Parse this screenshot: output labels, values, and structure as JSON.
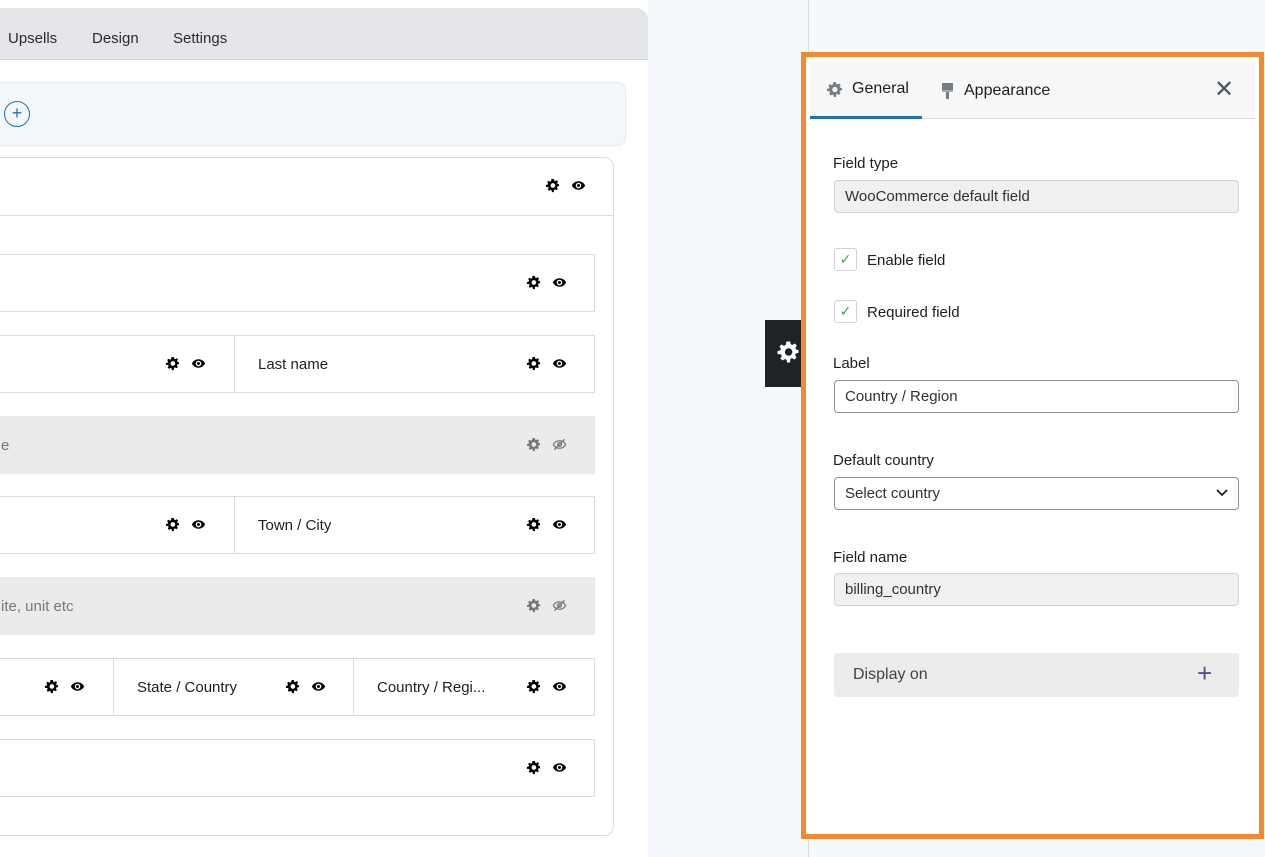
{
  "tabs": [
    "Upsells",
    "Design",
    "Settings"
  ],
  "fields": {
    "last_name": "Last name",
    "disabled_1": "e",
    "town_city": "Town / City",
    "disabled_2": "ite, unit etc",
    "state_country": "State / Country",
    "country_region": "Country / Regi..."
  },
  "panel": {
    "tab_general": "General",
    "tab_appearance": "Appearance",
    "field_type_label": "Field type",
    "field_type_value": "WooCommerce default field",
    "enable_field": "Enable field",
    "required_field": "Required field",
    "label_label": "Label",
    "label_value": "Country / Region",
    "default_country_label": "Default country",
    "default_country_value": "Select country",
    "field_name_label": "Field name",
    "field_name_value": "billing_country",
    "display_on": "Display on"
  },
  "icons": [
    "gear-icon",
    "eye-icon",
    "eye-slash-icon",
    "plus-icon",
    "close-icon",
    "chevron-down-icon",
    "brush-icon",
    "check-icon"
  ],
  "colors": {
    "accent": "#2271b1",
    "highlight": "#f5892e",
    "check": "#3aa14a"
  }
}
